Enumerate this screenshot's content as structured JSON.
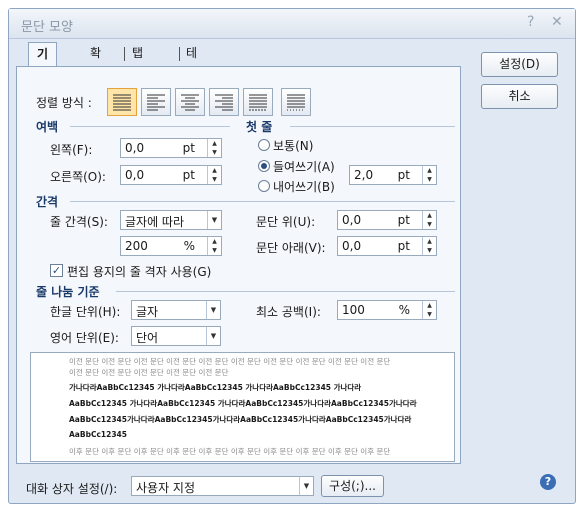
{
  "window": {
    "title": "문단 모양",
    "help_icon": "?",
    "close_icon": "✕"
  },
  "tabs": [
    {
      "label": "기본"
    },
    {
      "label": "확장"
    },
    {
      "label": "탭 설정"
    },
    {
      "label": "테두리/배경"
    }
  ],
  "buttons": {
    "ok": "설정(D)",
    "cancel": "취소",
    "config": "구성(;)..."
  },
  "align": {
    "label": "정렬 방식 :"
  },
  "margin": {
    "section": "여백",
    "left_label": "왼쪽(F):",
    "left_value": "0,0",
    "left_unit": "pt",
    "right_label": "오른쪽(O):",
    "right_value": "0,0",
    "right_unit": "pt"
  },
  "first_line": {
    "section": "첫 줄",
    "normal": "보통(N)",
    "indent": "들여쓰기(A)",
    "outdent": "내어쓰기(B)",
    "value": "2,0",
    "unit": "pt"
  },
  "spacing": {
    "section": "간격",
    "line_label": "줄 간격(S):",
    "line_mode": "글자에 따라",
    "line_value": "200",
    "line_unit": "%",
    "above_label": "문단 위(U):",
    "above_value": "0,0",
    "above_unit": "pt",
    "below_label": "문단 아래(V):",
    "below_value": "0,0",
    "below_unit": "pt",
    "grid_label": "편집 용지의 줄 격자 사용(G)"
  },
  "linebreak": {
    "section": "줄 나눔 기준",
    "hangul_label": "한글 단위(H):",
    "hangul_value": "글자",
    "english_label": "영어 단위(E):",
    "english_value": "단어",
    "minspace_label": "최소 공백(I):",
    "minspace_value": "100",
    "minspace_unit": "%"
  },
  "preview": {
    "lines": [
      "이전 문단 이전 문단 이전 문단 이전 문단 이전 문단 이전 문단 이전 문단 이전 문단 이전 문단 이전 문단",
      "이전 문단 이전 문단 이전 문단 이전 문단 이전 문단",
      "가나다라AaBbCc12345    가나다라AaBbCc12345    가나다라AaBbCc12345    가나다라",
      "AaBbCc12345 가나다라AaBbCc12345 가나다라AaBbCc12345가나다라AaBbCc12345가나다라",
      "AaBbCc12345가나다라AaBbCc12345가나다라AaBbCc12345가나다라AaBbCc12345가나다라",
      "AaBbCc12345",
      "이후 문단 이후 문단 이후 문단 이후 문단 이후 문단 이후 문단 이후 문단 이후 문단 이후 문단 이후 문단"
    ]
  },
  "footer": {
    "label": "대화 상자 설정(/):",
    "value": "사용자 지정"
  },
  "colors": {
    "accent": "#e6a23c",
    "panel": "#f4f7fb",
    "frame": "#dfe8f3"
  }
}
